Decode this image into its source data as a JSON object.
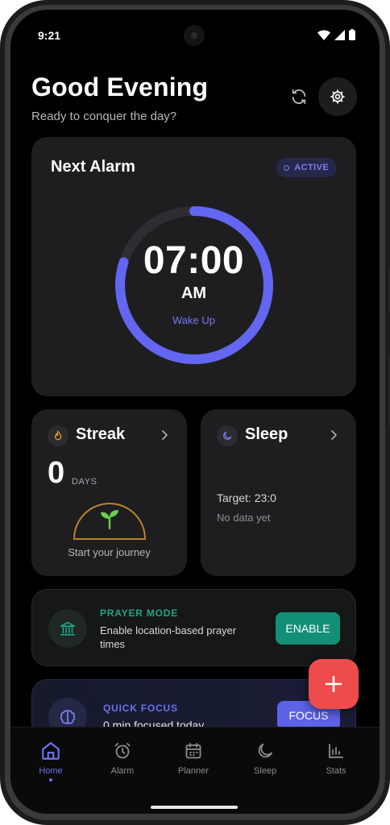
{
  "status_bar": {
    "time": "9:21",
    "icons": [
      "wifi-icon",
      "signal-icon",
      "battery-icon"
    ]
  },
  "header": {
    "title": "Good Evening",
    "subtitle": "Ready to conquer the day?",
    "refresh_icon": "refresh-icon",
    "settings_icon": "gear-icon"
  },
  "alarm": {
    "card_title": "Next Alarm",
    "badge": "ACTIVE",
    "time": "07:00",
    "ampm": "AM",
    "label": "Wake Up",
    "ring_progress": 0.8,
    "accent_color": "#6366F1"
  },
  "streak": {
    "title": "Streak",
    "count": "0",
    "unit": "DAYS",
    "caption": "Start your journey",
    "icon": "flame-icon"
  },
  "sleep": {
    "title": "Sleep",
    "target": "Target: 23:0",
    "empty_text": "No data yet",
    "icon": "moon-icon"
  },
  "prayer": {
    "title": "PRAYER MODE",
    "description": "Enable location-based prayer times",
    "button": "ENABLE",
    "icon": "mosque-icon",
    "accent_color": "#139B82"
  },
  "focus": {
    "title": "QUICK FOCUS",
    "description": "0 min focused today",
    "button": "FOCUS",
    "icon": "brain-icon"
  },
  "fab": {
    "icon": "plus-icon",
    "color": "#EE4C4C"
  },
  "nav": {
    "items": [
      {
        "label": "Home",
        "icon": "home-icon",
        "active": true
      },
      {
        "label": "Alarm",
        "icon": "alarm-clock-icon"
      },
      {
        "label": "Planner",
        "icon": "calendar-icon"
      },
      {
        "label": "Sleep",
        "icon": "moon-icon"
      },
      {
        "label": "Stats",
        "icon": "bar-chart-icon"
      }
    ]
  }
}
